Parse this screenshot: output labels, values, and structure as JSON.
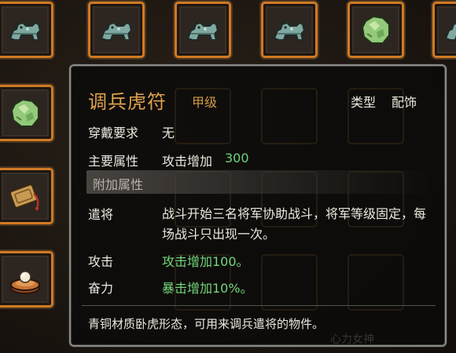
{
  "inventory": {
    "slots": [
      {
        "icon": "jade-tiger-tally-icon"
      },
      {
        "icon": "jade-tiger-tally-icon"
      },
      {
        "icon": "jade-tiger-tally-icon"
      },
      {
        "icon": "jade-tiger-tally-icon"
      },
      {
        "icon": "green-jade-stone-icon"
      },
      {
        "icon": "jade-tiger-tally-icon"
      },
      {
        "icon": "green-jade-stone-icon"
      },
      {
        "icon": "bronze-token-icon"
      },
      {
        "icon": "pearl-cushion-icon"
      }
    ]
  },
  "tooltip": {
    "title": "调兵虎符",
    "grade": "甲级",
    "type_label": "类型",
    "type_value": "配饰",
    "requirement_label": "穿戴要求",
    "requirement_value": "无",
    "main_attr_label": "主要属性",
    "main_attr_text": "攻击增加",
    "main_attr_value": "300",
    "extra_section": "附加属性",
    "skill_name": "遣将",
    "skill_desc": "战斗开始三名将军协助战斗，将军等级固定，每场战斗只出现一次。",
    "bonus1_label": "攻击",
    "bonus1_value": "攻击增加100。",
    "bonus2_label": "奋力",
    "bonus2_value": "暴击增加10%。",
    "flavor_text": "青铜材质卧虎形态，可用来调兵遣将的物件。",
    "watermark": "心力女神"
  },
  "colors": {
    "slot_border": "#d07a22",
    "title": "#e0a24f",
    "bonus_green": "#73d87e",
    "tooltip_border": "#8b8b87"
  }
}
